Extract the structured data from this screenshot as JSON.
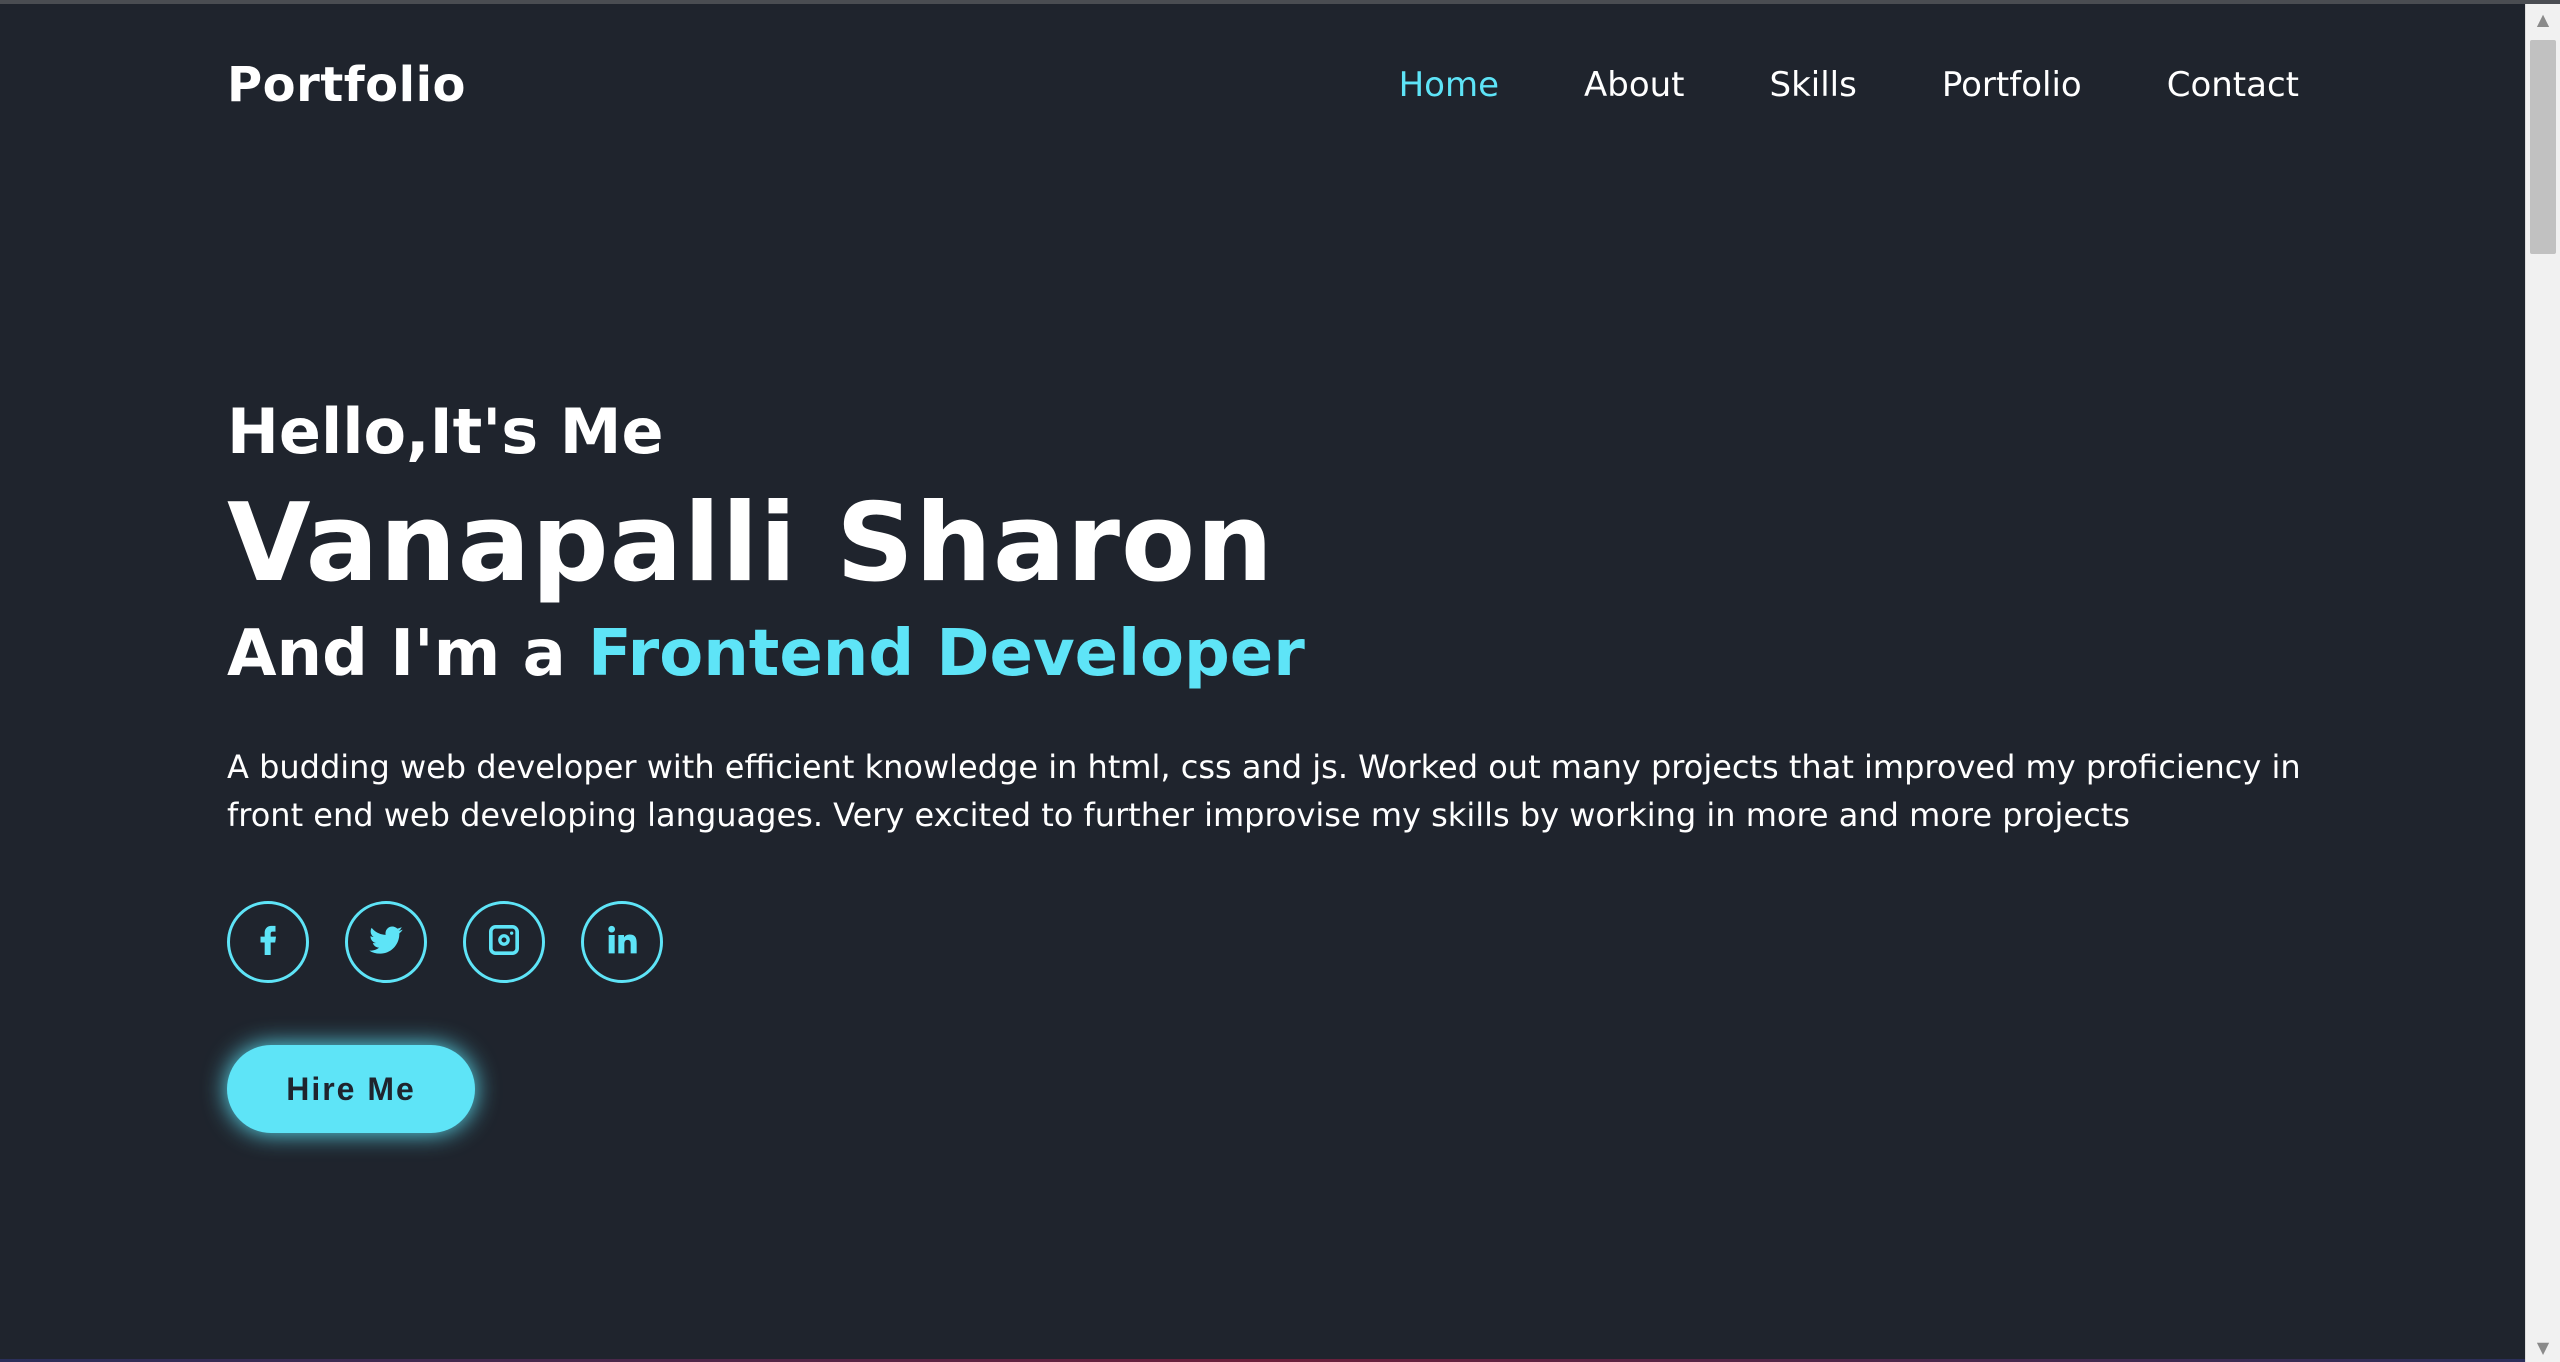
{
  "header": {
    "logo": "Portfolio",
    "nav": [
      {
        "label": "Home",
        "active": true
      },
      {
        "label": "About",
        "active": false
      },
      {
        "label": "Skills",
        "active": false
      },
      {
        "label": "Portfolio",
        "active": false
      },
      {
        "label": "Contact",
        "active": false
      }
    ]
  },
  "hero": {
    "greeting": "Hello,It's Me",
    "name": "Vanapalli Sharon",
    "role_prefix": "And I'm a ",
    "role_highlight": "Frontend Developer",
    "description": "A budding web developer with efficient knowledge in html, css and js. Worked out many projects that improved my proficiency in front end web developing languages. Very excited to further improvise my skills by working in more and more projects",
    "socials": [
      "facebook-icon",
      "twitter-icon",
      "instagram-icon",
      "linkedin-icon"
    ],
    "cta_label": "Hire Me"
  },
  "colors": {
    "background": "#1f242d",
    "accent": "#5ee4f7",
    "text": "#ffffff"
  },
  "scrollbar": {
    "up_arrow": "▲",
    "down_arrow": "▼"
  }
}
